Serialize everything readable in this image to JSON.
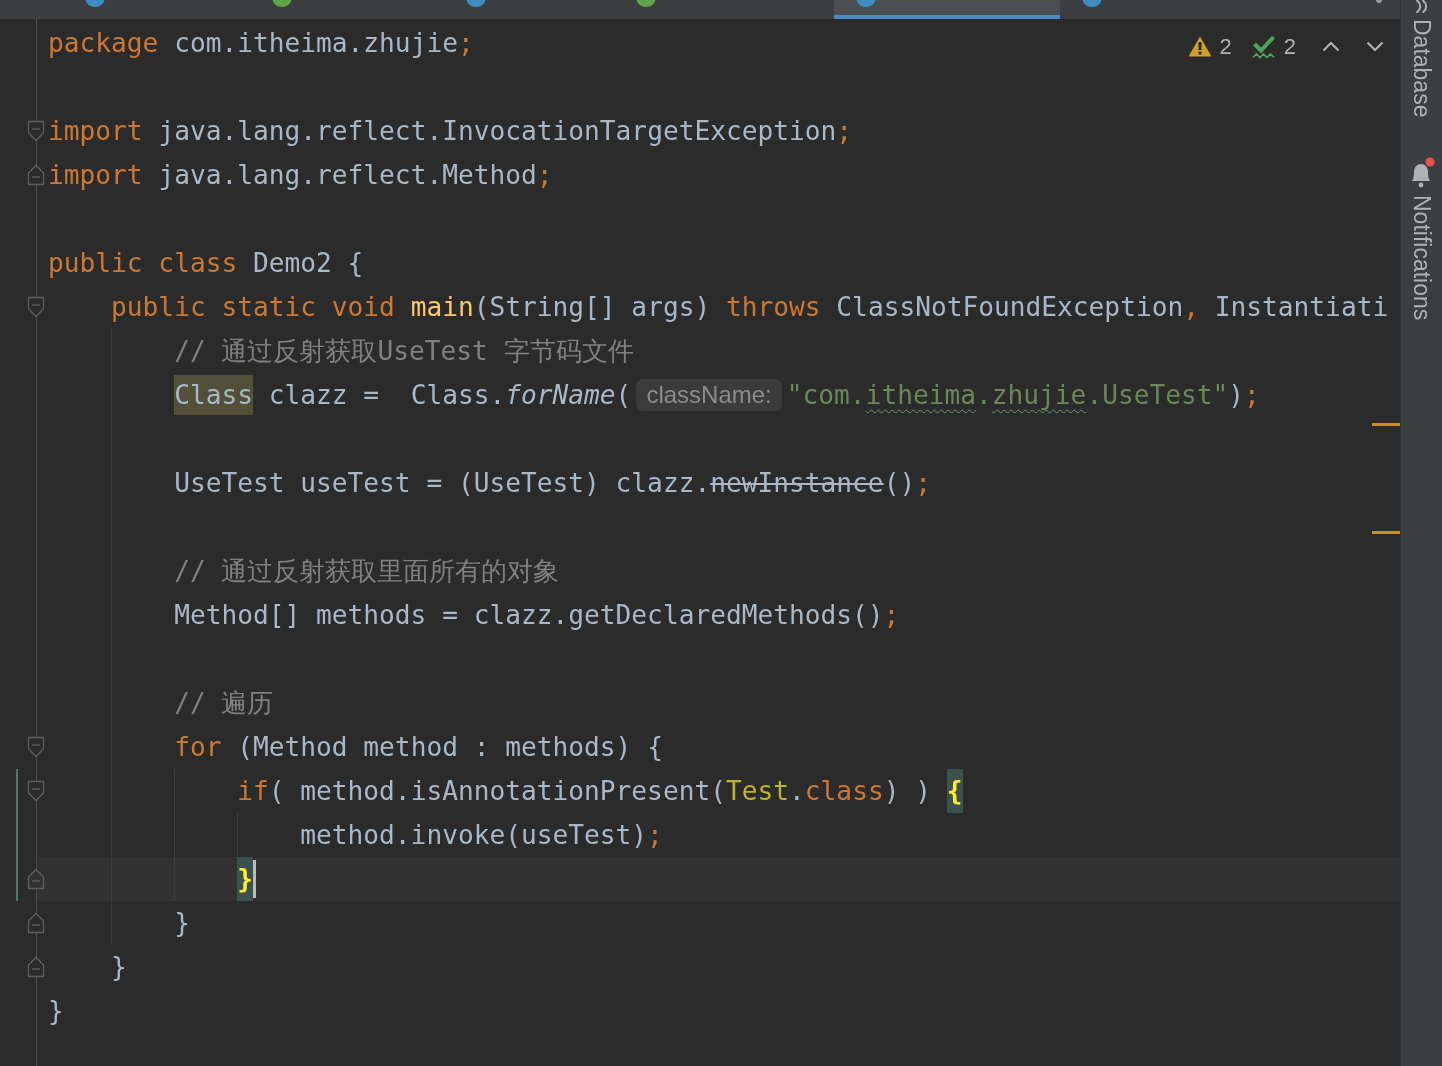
{
  "tabs": [
    {
      "color": "#3d8cc4",
      "selected": false
    },
    {
      "color": "#5fa648",
      "selected": false
    },
    {
      "color": "#3d8cc4",
      "selected": false
    },
    {
      "color": "#5fa648",
      "selected": false
    },
    {
      "color": "#3d8cc4",
      "selected": true
    },
    {
      "color": "#3d8cc4",
      "selected": false
    }
  ],
  "editor": {
    "inspections": [
      {
        "kind": "warning",
        "count": "2"
      },
      {
        "kind": "typo",
        "count": "2"
      }
    ],
    "lines": [
      {
        "kind": "code",
        "changed": false,
        "current": false,
        "warning": false,
        "tokens": [
          {
            "text": "package",
            "kind": "keyword"
          },
          {
            "text": " com.itheima.zhujie",
            "kind": "plain"
          },
          {
            "text": ";",
            "kind": "keyword"
          }
        ]
      },
      {
        "kind": "blank",
        "changed": false,
        "current": false,
        "warning": false
      },
      {
        "kind": "code",
        "fold": {
          "kind": "start"
        },
        "changed": false,
        "current": false,
        "warning": false,
        "tokens": [
          {
            "text": "import",
            "kind": "keyword"
          },
          {
            "text": " java.lang.reflect.InvocationTargetException",
            "kind": "plain"
          },
          {
            "text": ";",
            "kind": "keyword"
          }
        ]
      },
      {
        "kind": "code",
        "fold": {
          "kind": "end"
        },
        "changed": false,
        "current": false,
        "warning": false,
        "tokens": [
          {
            "text": "import",
            "kind": "keyword"
          },
          {
            "text": " java.lang.reflect.Method",
            "kind": "plain"
          },
          {
            "text": ";",
            "kind": "keyword"
          }
        ]
      },
      {
        "kind": "blank",
        "changed": false,
        "current": false,
        "warning": false
      },
      {
        "kind": "code",
        "changed": false,
        "current": false,
        "warning": false,
        "tokens": [
          {
            "text": "public class",
            "kind": "keyword"
          },
          {
            "text": " Demo2 {",
            "kind": "plain"
          }
        ]
      },
      {
        "kind": "code",
        "fold": {
          "kind": "start"
        },
        "changed": false,
        "current": false,
        "warning": false,
        "tokens": [
          {
            "text": "    public static void ",
            "kind": "keyword"
          },
          {
            "text": "main",
            "kind": "method_declaration"
          },
          {
            "text": "(String[] args) ",
            "kind": "plain"
          },
          {
            "text": "throws",
            "kind": "keyword"
          },
          {
            "text": " ClassNotFoundException",
            "kind": "plain"
          },
          {
            "text": ",",
            "kind": "keyword"
          },
          {
            "text": " Instantiati",
            "kind": "plain"
          }
        ]
      },
      {
        "kind": "code",
        "changed": false,
        "current": false,
        "warning": false,
        "tokens": [
          {
            "text": "        // 通过反射获取UseTest 字节码文件",
            "kind": "comment"
          }
        ]
      },
      {
        "kind": "code",
        "changed": false,
        "current": false,
        "warning": true,
        "tokens": [
          {
            "text": "        Class",
            "kind": "usage_highlight"
          },
          {
            "text": " clazz =  Class.",
            "kind": "plain"
          },
          {
            "text": "forName",
            "kind": "static_call"
          },
          {
            "text": "(",
            "kind": "plain"
          },
          {
            "text": "className:",
            "kind": "parameter_hint"
          },
          {
            "text": "\"com.",
            "kind": "string"
          },
          {
            "text": "itheima",
            "kind": "string_typo"
          },
          {
            "text": ".",
            "kind": "string"
          },
          {
            "text": "zhujie",
            "kind": "string_typo"
          },
          {
            "text": ".UseTest\"",
            "kind": "string"
          },
          {
            "text": ")",
            "kind": "plain"
          },
          {
            "text": ";",
            "kind": "keyword"
          }
        ]
      },
      {
        "kind": "blank",
        "changed": false,
        "current": false,
        "warning": false
      },
      {
        "kind": "code",
        "changed": false,
        "current": false,
        "warning": true,
        "tokens": [
          {
            "text": "        UseTest useTest = (UseTest) clazz.",
            "kind": "plain"
          },
          {
            "text": "newInstance",
            "kind": "deprecated"
          },
          {
            "text": "()",
            "kind": "plain"
          },
          {
            "text": ";",
            "kind": "keyword"
          }
        ]
      },
      {
        "kind": "blank",
        "changed": false,
        "current": false,
        "warning": false
      },
      {
        "kind": "code",
        "changed": false,
        "current": false,
        "warning": false,
        "tokens": [
          {
            "text": "        // 通过反射获取里面所有的对象",
            "kind": "comment"
          }
        ]
      },
      {
        "kind": "code",
        "changed": false,
        "current": false,
        "warning": false,
        "tokens": [
          {
            "text": "        Method[] methods = clazz.getDeclaredMethods()",
            "kind": "plain"
          },
          {
            "text": ";",
            "kind": "keyword"
          }
        ]
      },
      {
        "kind": "blank",
        "changed": false,
        "current": false,
        "warning": false
      },
      {
        "kind": "code",
        "changed": false,
        "current": false,
        "warning": false,
        "tokens": [
          {
            "text": "        // 遍历",
            "kind": "comment"
          }
        ]
      },
      {
        "kind": "code",
        "fold": {
          "kind": "start"
        },
        "changed": false,
        "current": false,
        "warning": false,
        "tokens": [
          {
            "text": "        for",
            "kind": "keyword"
          },
          {
            "text": " (Method method : methods) {",
            "kind": "plain"
          }
        ]
      },
      {
        "kind": "code",
        "fold": {
          "kind": "start"
        },
        "changed": true,
        "current": false,
        "warning": false,
        "tokens": [
          {
            "text": "            if",
            "kind": "keyword"
          },
          {
            "text": "( method.isAnnotationPresent(",
            "kind": "plain"
          },
          {
            "text": "Test.class",
            "kind": "class_literal"
          },
          {
            "text": ") ) ",
            "kind": "plain"
          },
          {
            "text": "{",
            "kind": "brace_match"
          }
        ]
      },
      {
        "kind": "code",
        "changed": true,
        "current": false,
        "warning": false,
        "tokens": [
          {
            "text": "                method.invoke(useTest)",
            "kind": "plain"
          },
          {
            "text": ";",
            "kind": "keyword"
          }
        ]
      },
      {
        "kind": "code",
        "fold": {
          "kind": "end"
        },
        "changed": true,
        "current": true,
        "warning": false,
        "tokens": [
          {
            "text": "            }",
            "kind": "brace_match"
          }
        ]
      },
      {
        "kind": "code",
        "fold": {
          "kind": "end"
        },
        "changed": false,
        "current": false,
        "warning": false,
        "tokens": [
          {
            "text": "        }",
            "kind": "plain"
          }
        ]
      },
      {
        "kind": "code",
        "fold": {
          "kind": "end"
        },
        "changed": false,
        "current": false,
        "warning": false,
        "tokens": [
          {
            "text": "    }",
            "kind": "plain"
          }
        ]
      },
      {
        "kind": "code",
        "changed": false,
        "current": false,
        "warning": false,
        "tokens": [
          {
            "text": "}",
            "kind": "plain"
          }
        ]
      }
    ]
  },
  "sidebar": {
    "items": [
      {
        "kind": "database",
        "label": "Database",
        "unread": false
      },
      {
        "kind": "notifications",
        "label": "Notifications",
        "unread": true
      }
    ]
  }
}
